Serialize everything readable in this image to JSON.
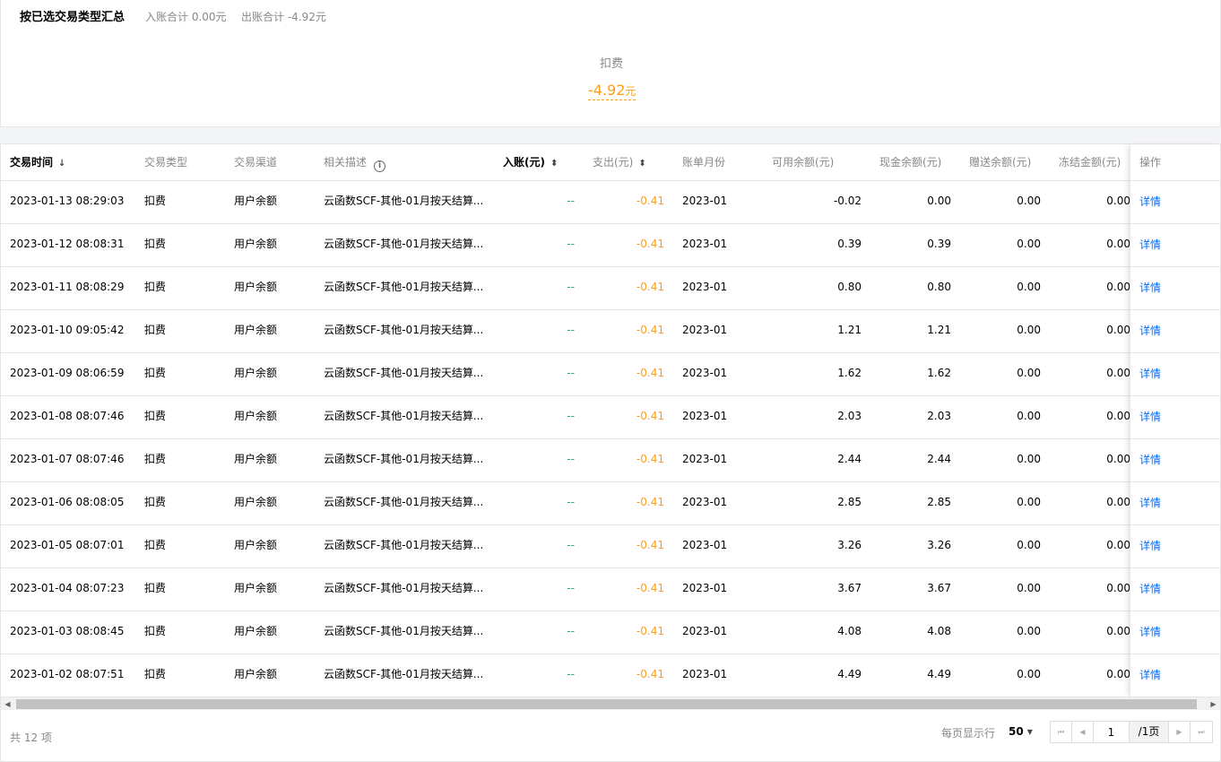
{
  "summary": {
    "title": "按已选交易类型汇总",
    "income_total": "入账合计 0.00元",
    "expense_total": "出账合计 -4.92元",
    "card_label": "扣费",
    "card_value": "-4.92",
    "card_unit": "元"
  },
  "table": {
    "headers": {
      "time": "交易时间",
      "type": "交易类型",
      "channel": "交易渠道",
      "desc": "相关描述",
      "income": "入账(元)",
      "expense": "支出(元)",
      "month": "账单月份",
      "available": "可用余额(元)",
      "cash": "现金余额(元)",
      "gift": "赠送余额(元)",
      "frozen": "冻结金额(元)",
      "action": "操作"
    },
    "icons": {
      "sort_desc": "arrow-down-icon",
      "sort": "sort-icon",
      "info": "info-icon"
    },
    "rows": [
      {
        "time": "2023-01-13 08:29:03",
        "type": "扣费",
        "channel": "用户余额",
        "desc": "云函数SCF-其他-01月按天结算...",
        "income": "--",
        "expense": "-0.41",
        "month": "2023-01",
        "available": "-0.02",
        "cash": "0.00",
        "gift": "0.00",
        "frozen": "0.00",
        "action": "详情"
      },
      {
        "time": "2023-01-12 08:08:31",
        "type": "扣费",
        "channel": "用户余额",
        "desc": "云函数SCF-其他-01月按天结算...",
        "income": "--",
        "expense": "-0.41",
        "month": "2023-01",
        "available": "0.39",
        "cash": "0.39",
        "gift": "0.00",
        "frozen": "0.00",
        "action": "详情"
      },
      {
        "time": "2023-01-11 08:08:29",
        "type": "扣费",
        "channel": "用户余额",
        "desc": "云函数SCF-其他-01月按天结算...",
        "income": "--",
        "expense": "-0.41",
        "month": "2023-01",
        "available": "0.80",
        "cash": "0.80",
        "gift": "0.00",
        "frozen": "0.00",
        "action": "详情"
      },
      {
        "time": "2023-01-10 09:05:42",
        "type": "扣费",
        "channel": "用户余额",
        "desc": "云函数SCF-其他-01月按天结算...",
        "income": "--",
        "expense": "-0.41",
        "month": "2023-01",
        "available": "1.21",
        "cash": "1.21",
        "gift": "0.00",
        "frozen": "0.00",
        "action": "详情"
      },
      {
        "time": "2023-01-09 08:06:59",
        "type": "扣费",
        "channel": "用户余额",
        "desc": "云函数SCF-其他-01月按天结算...",
        "income": "--",
        "expense": "-0.41",
        "month": "2023-01",
        "available": "1.62",
        "cash": "1.62",
        "gift": "0.00",
        "frozen": "0.00",
        "action": "详情"
      },
      {
        "time": "2023-01-08 08:07:46",
        "type": "扣费",
        "channel": "用户余额",
        "desc": "云函数SCF-其他-01月按天结算...",
        "income": "--",
        "expense": "-0.41",
        "month": "2023-01",
        "available": "2.03",
        "cash": "2.03",
        "gift": "0.00",
        "frozen": "0.00",
        "action": "详情"
      },
      {
        "time": "2023-01-07 08:07:46",
        "type": "扣费",
        "channel": "用户余额",
        "desc": "云函数SCF-其他-01月按天结算...",
        "income": "--",
        "expense": "-0.41",
        "month": "2023-01",
        "available": "2.44",
        "cash": "2.44",
        "gift": "0.00",
        "frozen": "0.00",
        "action": "详情"
      },
      {
        "time": "2023-01-06 08:08:05",
        "type": "扣费",
        "channel": "用户余额",
        "desc": "云函数SCF-其他-01月按天结算...",
        "income": "--",
        "expense": "-0.41",
        "month": "2023-01",
        "available": "2.85",
        "cash": "2.85",
        "gift": "0.00",
        "frozen": "0.00",
        "action": "详情"
      },
      {
        "time": "2023-01-05 08:07:01",
        "type": "扣费",
        "channel": "用户余额",
        "desc": "云函数SCF-其他-01月按天结算...",
        "income": "--",
        "expense": "-0.41",
        "month": "2023-01",
        "available": "3.26",
        "cash": "3.26",
        "gift": "0.00",
        "frozen": "0.00",
        "action": "详情"
      },
      {
        "time": "2023-01-04 08:07:23",
        "type": "扣费",
        "channel": "用户余额",
        "desc": "云函数SCF-其他-01月按天结算...",
        "income": "--",
        "expense": "-0.41",
        "month": "2023-01",
        "available": "3.67",
        "cash": "3.67",
        "gift": "0.00",
        "frozen": "0.00",
        "action": "详情"
      },
      {
        "time": "2023-01-03 08:08:45",
        "type": "扣费",
        "channel": "用户余额",
        "desc": "云函数SCF-其他-01月按天结算...",
        "income": "--",
        "expense": "-0.41",
        "month": "2023-01",
        "available": "4.08",
        "cash": "4.08",
        "gift": "0.00",
        "frozen": "0.00",
        "action": "详情"
      },
      {
        "time": "2023-01-02 08:07:51",
        "type": "扣费",
        "channel": "用户余额",
        "desc": "云函数SCF-其他-01月按天结算...",
        "income": "--",
        "expense": "-0.41",
        "month": "2023-01",
        "available": "4.49",
        "cash": "4.49",
        "gift": "0.00",
        "frozen": "0.00",
        "action": "详情"
      }
    ]
  },
  "footer": {
    "total_text": "共 12 项",
    "per_page_label": "每页显示行",
    "per_page_value": "50",
    "page_input": "1",
    "page_total": "/1页"
  },
  "colors": {
    "accent_link": "#006eff",
    "expense_orange": "#ff9c19",
    "income_green": "#0abf5b"
  }
}
